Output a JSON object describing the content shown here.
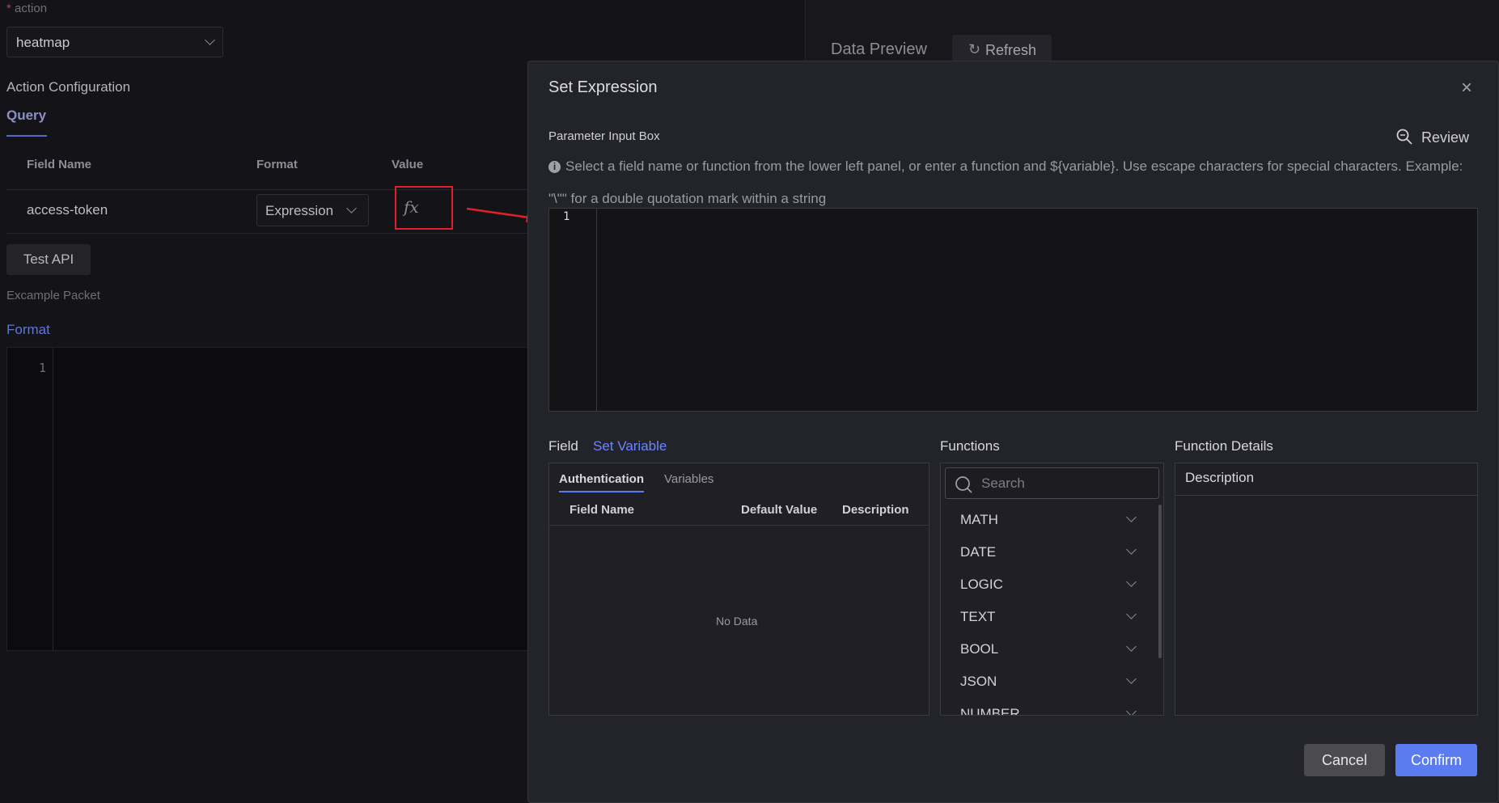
{
  "background": {
    "action_label": "action",
    "action_select_value": "heatmap",
    "action_config_title": "Action Configuration",
    "query_tab": "Query",
    "table_headers": [
      "Field Name",
      "Format",
      "Value"
    ],
    "row": {
      "field_name": "access-token",
      "format": "Expression",
      "value_icon": "fx"
    },
    "test_api_button": "Test API",
    "example_packet_label": "Excample Packet",
    "format_link": "Format",
    "editor_line_number": "1",
    "data_preview_title": "Data Preview",
    "refresh_button": "Refresh"
  },
  "dialog": {
    "title": "Set Expression",
    "parameter_input_label": "Parameter Input Box",
    "review_button": "Review",
    "hint_text": "Select a field name or function from the lower left panel, or enter a function and ${variable}. Use escape characters for special characters. Example: \"\\\"\" for a double quotation mark within a string",
    "editor_line_number": "1",
    "field_label": "Field",
    "set_variable_link": "Set Variable",
    "field_tabs": [
      "Authentication",
      "Variables"
    ],
    "field_table_headers": [
      "Field Name",
      "Default Value",
      "Description"
    ],
    "no_data": "No Data",
    "functions_label": "Functions",
    "search_placeholder": "Search",
    "function_categories": [
      "MATH",
      "DATE",
      "LOGIC",
      "TEXT",
      "BOOL",
      "JSON",
      "NUMBER"
    ],
    "function_details_label": "Function Details",
    "description_header": "Description",
    "cancel_button": "Cancel",
    "confirm_button": "Confirm"
  },
  "colors": {
    "accent": "#5b7cf0",
    "annotation_red": "#e0202a"
  }
}
